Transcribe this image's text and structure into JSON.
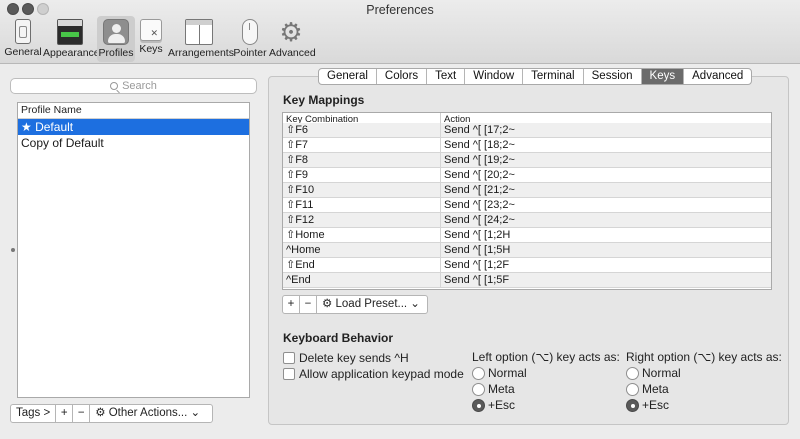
{
  "window": {
    "title": "Preferences"
  },
  "toolbar": [
    {
      "label": "General",
      "icon": "general-icon"
    },
    {
      "label": "Appearance",
      "icon": "appearance-icon"
    },
    {
      "label": "Profiles",
      "icon": "profiles-icon"
    },
    {
      "label": "Keys",
      "icon": "keys-icon"
    },
    {
      "label": "Arrangements",
      "icon": "arrangements-icon"
    },
    {
      "label": "Pointer",
      "icon": "pointer-icon"
    },
    {
      "label": "Advanced",
      "icon": "gear-icon",
      "glyph": "⚙"
    }
  ],
  "profiles_pane": {
    "search_placeholder": "Search",
    "column_header": "Profile Name",
    "items": [
      "★ Default",
      "Copy of Default"
    ],
    "tags_label": "Tags >",
    "add_label": "+",
    "remove_label": "−",
    "other_actions_label": "⚙ Other Actions... ⌄"
  },
  "tabs": [
    "General",
    "Colors",
    "Text",
    "Window",
    "Terminal",
    "Session",
    "Keys",
    "Advanced"
  ],
  "key_mappings": {
    "title": "Key Mappings",
    "col_combination": "Key Combination",
    "col_action": "Action",
    "rows": [
      {
        "combo": "⇧F6",
        "action": "Send ^[ [17;2~"
      },
      {
        "combo": "⇧F7",
        "action": "Send ^[ [18;2~"
      },
      {
        "combo": "⇧F8",
        "action": "Send ^[ [19;2~"
      },
      {
        "combo": "⇧F9",
        "action": "Send ^[ [20;2~"
      },
      {
        "combo": "⇧F10",
        "action": "Send ^[ [21;2~"
      },
      {
        "combo": "⇧F11",
        "action": "Send ^[ [23;2~"
      },
      {
        "combo": "⇧F12",
        "action": "Send ^[ [24;2~"
      },
      {
        "combo": "⇧Home",
        "action": "Send ^[ [1;2H"
      },
      {
        "combo": "^Home",
        "action": "Send ^[ [1;5H"
      },
      {
        "combo": "⇧End",
        "action": "Send ^[ [1;2F"
      },
      {
        "combo": "^End",
        "action": "Send ^[ [1;5F"
      }
    ],
    "add_label": "+",
    "remove_label": "−",
    "load_preset_label": "⚙ Load Preset... ⌄"
  },
  "keyboard_behavior": {
    "title": "Keyboard Behavior",
    "delete_sends_h": "Delete key sends ^H",
    "app_keypad": "Allow application keypad mode",
    "left_option_label": "Left option (⌥) key acts as:",
    "right_option_label": "Right option (⌥) key acts as:",
    "options": [
      "Normal",
      "Meta",
      "+Esc"
    ],
    "left_selected": "+Esc",
    "right_selected": "+Esc"
  }
}
